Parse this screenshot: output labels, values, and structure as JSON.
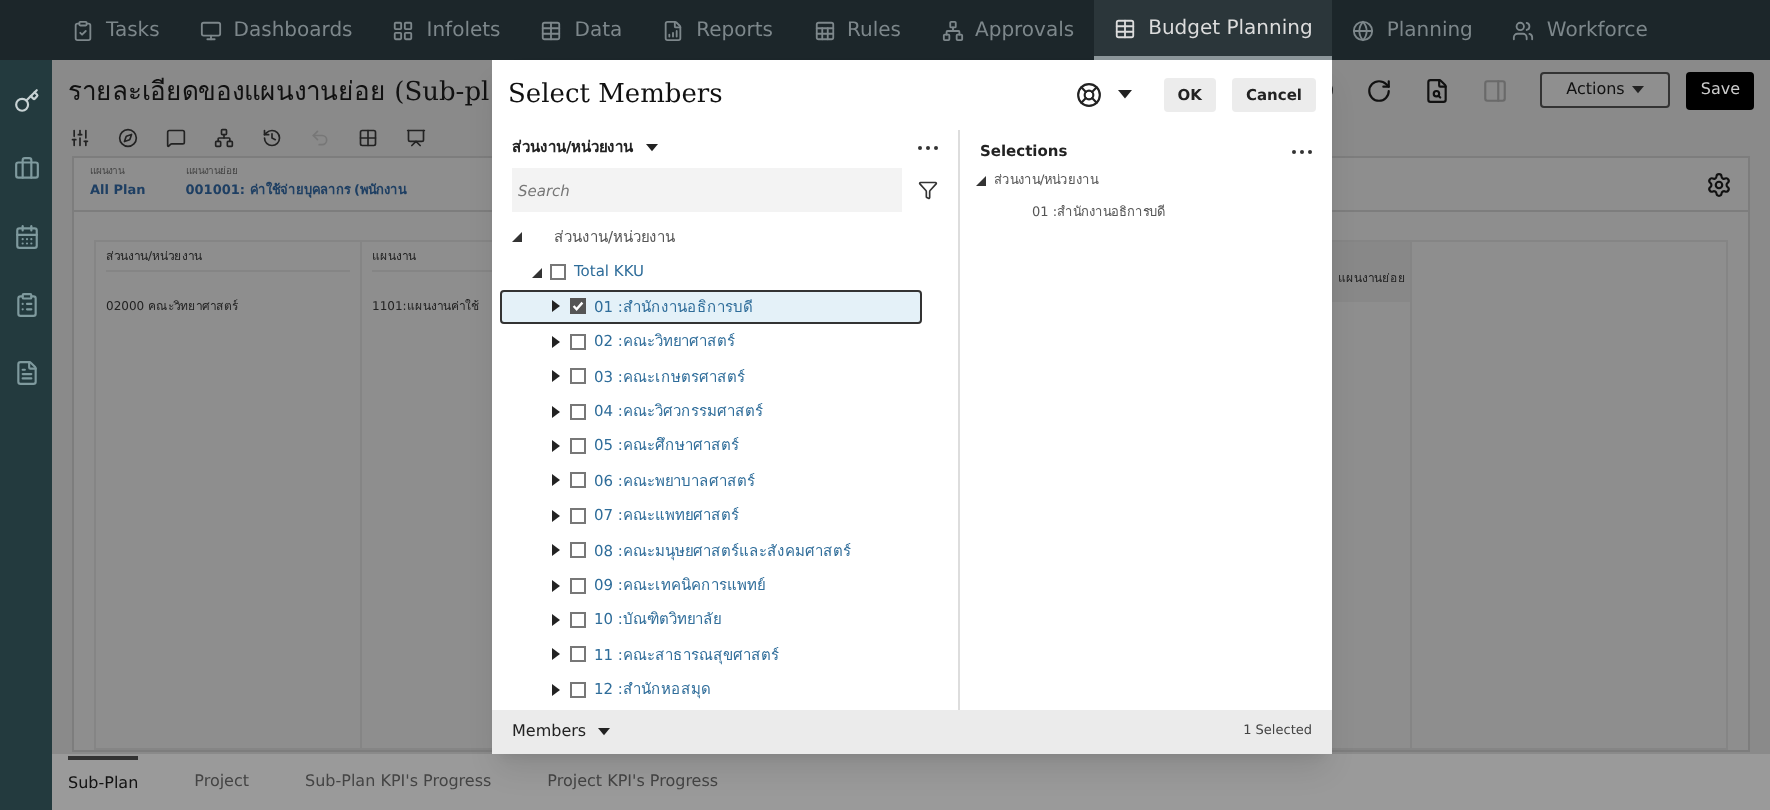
{
  "nav": {
    "items": [
      {
        "label": "Tasks",
        "selected": false
      },
      {
        "label": "Dashboards",
        "selected": false
      },
      {
        "label": "Infolets",
        "selected": false
      },
      {
        "label": "Data",
        "selected": false
      },
      {
        "label": "Reports",
        "selected": false
      },
      {
        "label": "Rules",
        "selected": false
      },
      {
        "label": "Approvals",
        "selected": false
      },
      {
        "label": "Budget Planning",
        "selected": true
      },
      {
        "label": "Planning",
        "selected": false
      },
      {
        "label": "Workforce",
        "selected": false
      }
    ]
  },
  "page": {
    "title": "รายละเอียดของแผนงานย่อย (Sub-pl",
    "actions_button": "Actions",
    "save_button": "Save",
    "filters": [
      {
        "label": "แผนงาน",
        "value": "All Plan"
      },
      {
        "label": "แผนงานย่อย",
        "value": "001001: ค่าใช้จ่ายบุคลากร (พนักงาน"
      }
    ],
    "grid": {
      "columns": [
        "ส่วนงาน/หน่วยงาน",
        "แผนงาน"
      ],
      "right_column": "แผนงานย่อย",
      "rows": [
        [
          "02000 คณะวิทยาศาสตร์",
          "1101:แผนงานค่าใช้"
        ]
      ]
    }
  },
  "dialog": {
    "title": "Select Members",
    "ok_button": "OK",
    "cancel_button": "Cancel",
    "dimension": "ส่วนงาน/หน่วยงาน",
    "search": {
      "placeholder": "Search"
    },
    "tree": {
      "label": "ส่วนงาน/หน่วยงาน",
      "expanded": true,
      "children": [
        {
          "label": "Total KKU",
          "expanded": true,
          "checked": false,
          "selected": false,
          "children": [
            {
              "label": "01 :สำนักงานอธิการบดี",
              "expanded": false,
              "checked": true,
              "selected": true
            },
            {
              "label": "02 :คณะวิทยาศาสตร์",
              "expanded": false,
              "checked": false,
              "selected": false
            },
            {
              "label": "03 :คณะเกษตรศาสตร์",
              "expanded": false,
              "checked": false,
              "selected": false
            },
            {
              "label": "04 :คณะวิศวกรรมศาสตร์",
              "expanded": false,
              "checked": false,
              "selected": false
            },
            {
              "label": "05 :คณะศึกษาศาสตร์",
              "expanded": false,
              "checked": false,
              "selected": false
            },
            {
              "label": "06 :คณะพยาบาลศาสตร์",
              "expanded": false,
              "checked": false,
              "selected": false
            },
            {
              "label": "07 :คณะแพทยศาสตร์",
              "expanded": false,
              "checked": false,
              "selected": false
            },
            {
              "label": "08 :คณะมนุษยศาสตร์และสังคมศาสตร์",
              "expanded": false,
              "checked": false,
              "selected": false
            },
            {
              "label": "09 :คณะเทคนิคการแพทย์",
              "expanded": false,
              "checked": false,
              "selected": false
            },
            {
              "label": "10 :บัณฑิตวิทยาลัย",
              "expanded": false,
              "checked": false,
              "selected": false
            },
            {
              "label": "11 :คณะสาธารณสุขศาสตร์",
              "expanded": false,
              "checked": false,
              "selected": false
            },
            {
              "label": "12 :สำนักหอสมุด",
              "expanded": false,
              "checked": false,
              "selected": false
            }
          ]
        }
      ]
    },
    "selections": {
      "title": "Selections",
      "root": "ส่วนงาน/หน่วยงาน",
      "items": [
        "01 :สำนักงานอธิการบดี"
      ]
    },
    "footer": {
      "view": "Members",
      "count": "1 Selected"
    }
  },
  "bottom_tabs": [
    {
      "label": "Sub-Plan",
      "selected": true
    },
    {
      "label": "Project",
      "selected": false
    },
    {
      "label": "Sub-Plan KPI's Progress",
      "selected": false
    },
    {
      "label": "Project KPI's Progress",
      "selected": false
    }
  ]
}
